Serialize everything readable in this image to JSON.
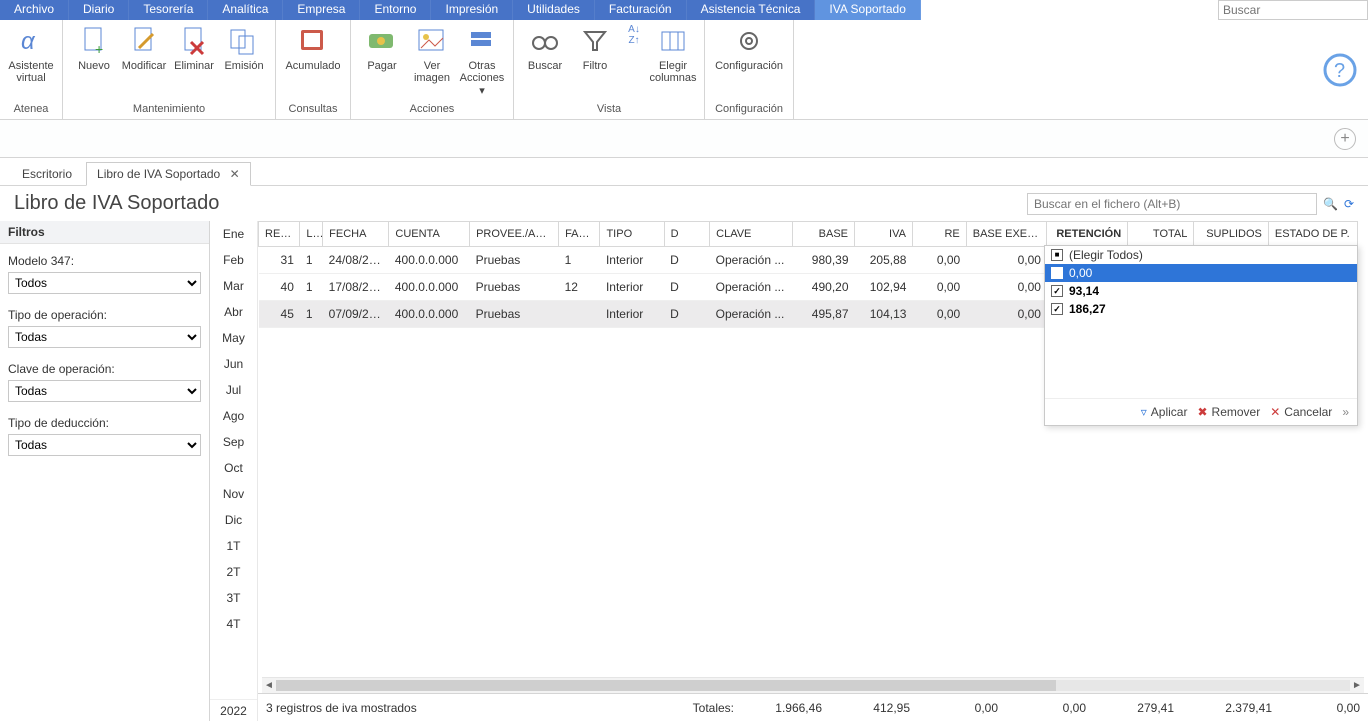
{
  "menu": [
    "Archivo",
    "Diario",
    "Tesorería",
    "Analítica",
    "Empresa",
    "Entorno",
    "Impresión",
    "Utilidades",
    "Facturación",
    "Asistencia Técnica",
    "IVA Soportado"
  ],
  "menu_active_index": 10,
  "top_search_placeholder": "Buscar",
  "ribbon": {
    "groups": [
      {
        "label": "Atenea",
        "items": [
          {
            "name": "asistente",
            "label": "Asistente\nvirtual"
          }
        ]
      },
      {
        "label": "Mantenimiento",
        "items": [
          {
            "name": "nuevo",
            "label": "Nuevo"
          },
          {
            "name": "modificar",
            "label": "Modificar"
          },
          {
            "name": "eliminar",
            "label": "Eliminar"
          },
          {
            "name": "emision",
            "label": "Emisión"
          }
        ]
      },
      {
        "label": "Consultas",
        "items": [
          {
            "name": "acumulado",
            "label": "Acumulado"
          }
        ]
      },
      {
        "label": "Acciones",
        "items": [
          {
            "name": "pagar",
            "label": "Pagar"
          },
          {
            "name": "ver-imagen",
            "label": "Ver\nimagen"
          },
          {
            "name": "otras",
            "label": "Otras\nAcciones ▾"
          }
        ]
      },
      {
        "label": "Vista",
        "items": [
          {
            "name": "buscar",
            "label": "Buscar"
          },
          {
            "name": "filtro",
            "label": "Filtro"
          },
          {
            "name": "ordenar",
            "label": ""
          },
          {
            "name": "columnas",
            "label": "Elegir\ncolumnas"
          }
        ]
      },
      {
        "label": "Configuración",
        "items": [
          {
            "name": "config",
            "label": "Configuración"
          }
        ]
      }
    ]
  },
  "tabs": {
    "desktop": "Escritorio",
    "active": "Libro de IVA Soportado"
  },
  "page_title": "Libro de IVA Soportado",
  "find_placeholder": "Buscar en el fichero (Alt+B)",
  "filters": {
    "header": "Filtros",
    "modelo_label": "Modelo 347:",
    "modelo_value": "Todos",
    "tipo_op_label": "Tipo de operación:",
    "tipo_op_value": "Todas",
    "clave_op_label": "Clave de operación:",
    "clave_op_value": "Todas",
    "tipo_ded_label": "Tipo de deducción:",
    "tipo_ded_value": "Todas"
  },
  "months": [
    "Ene",
    "Feb",
    "Mar",
    "Abr",
    "May",
    "Jun",
    "Jul",
    "Ago",
    "Sep",
    "Oct",
    "Nov",
    "Dic",
    "1T",
    "2T",
    "3T",
    "4T"
  ],
  "year": "2022",
  "columns": [
    "REG...",
    "L...",
    "FECHA",
    "CUENTA",
    "PROVEE./AC...",
    "FAC...",
    "TIPO",
    "D",
    "CLAVE",
    "BASE",
    "IVA",
    "RE",
    "BASE EXENTA",
    "RETENCIÓN",
    "TOTAL",
    "SUPLIDOS",
    "ESTADO DE P."
  ],
  "active_col_index": 13,
  "rows": [
    {
      "reg": "31",
      "l": "1",
      "fecha": "24/08/20...",
      "cuenta": "400.0.0.000",
      "prov": "Pruebas",
      "fac": "1",
      "tipo": "Interior",
      "d": "D",
      "clave": "Operación ...",
      "base": "980,39",
      "iva": "205,88",
      "re": "0,00",
      "exenta": "0,00"
    },
    {
      "reg": "40",
      "l": "1",
      "fecha": "17/08/20...",
      "cuenta": "400.0.0.000",
      "prov": "Pruebas",
      "fac": "12",
      "tipo": "Interior",
      "d": "D",
      "clave": "Operación ...",
      "base": "490,20",
      "iva": "102,94",
      "re": "0,00",
      "exenta": "0,00"
    },
    {
      "reg": "45",
      "l": "1",
      "fecha": "07/09/20...",
      "cuenta": "400.0.0.000",
      "prov": "Pruebas",
      "fac": "",
      "tipo": "Interior",
      "d": "D",
      "clave": "Operación ...",
      "base": "495,87",
      "iva": "104,13",
      "re": "0,00",
      "exenta": "0,00"
    }
  ],
  "popover": {
    "all": "(Elegir Todos)",
    "opts": [
      "0,00",
      "93,14",
      "186,27"
    ],
    "apply": "Aplicar",
    "remove": "Remover",
    "cancel": "Cancelar"
  },
  "status_text": "3 registros de iva mostrados",
  "totals_label": "Totales:",
  "totals": [
    "1.966,46",
    "412,95",
    "0,00",
    "0,00",
    "279,41",
    "2.379,41",
    "0,00"
  ]
}
